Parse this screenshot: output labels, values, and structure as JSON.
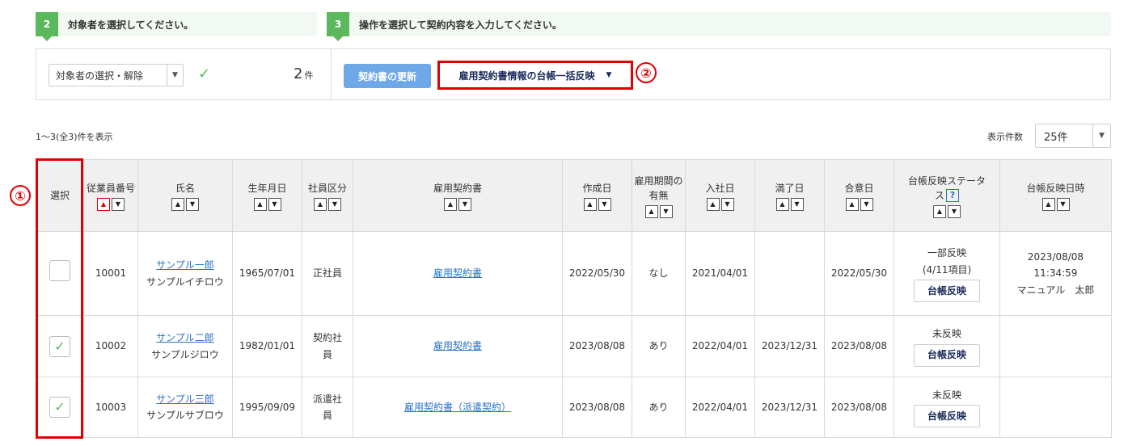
{
  "steps": [
    {
      "num": "2",
      "title": "対象者を選択してください。"
    },
    {
      "num": "3",
      "title": "操作を選択して契約内容を入力してください。"
    }
  ],
  "action_bar": {
    "target_select_label": "対象者の選択・解除",
    "count": "2",
    "count_unit": "件",
    "update_button": "契約書の更新",
    "bulk_button": "雇用契約書情報の台帳一括反映"
  },
  "markers": {
    "one": "①",
    "two": "②"
  },
  "list": {
    "range_text": "1～3(全3)件を表示",
    "per_page_label": "表示件数",
    "per_page_value": "25件"
  },
  "table": {
    "headers": {
      "select": "選択",
      "emp_no": "従業員番号",
      "name": "氏名",
      "birth": "生年月日",
      "emp_type": "社員区分",
      "contract": "雇用契約書",
      "created": "作成日",
      "period": "雇用期間の有無",
      "join": "入社日",
      "expire": "満了日",
      "agree": "合意日",
      "status": "台帳反映ステータス",
      "reflected_at": "台帳反映日時"
    },
    "rows": [
      {
        "checked": false,
        "emp_no": "10001",
        "name": "サンプル一郎",
        "kana": "サンプルイチロウ",
        "birth": "1965/07/01",
        "emp_type": "正社員",
        "contract": "雇用契約書",
        "created": "2022/05/30",
        "period": "なし",
        "join": "2021/04/01",
        "expire": "",
        "agree": "2022/05/30",
        "status": "一部反映",
        "status_detail": "(4/11項目)",
        "button": "台帳反映",
        "reflected_date": "2023/08/08",
        "reflected_time": "11:34:59",
        "reflected_by": "マニュアル　太郎"
      },
      {
        "checked": true,
        "emp_no": "10002",
        "name": "サンプル二郎",
        "kana": "サンプルジロウ",
        "birth": "1982/01/01",
        "emp_type": "契約社員",
        "contract": "雇用契約書",
        "created": "2023/08/08",
        "period": "あり",
        "join": "2022/04/01",
        "expire": "2023/12/31",
        "agree": "2023/08/08",
        "status": "未反映",
        "status_detail": "",
        "button": "台帳反映",
        "reflected_date": "",
        "reflected_time": "",
        "reflected_by": ""
      },
      {
        "checked": true,
        "emp_no": "10003",
        "name": "サンプル三郎",
        "kana": "サンプルサブロウ",
        "birth": "1995/09/09",
        "emp_type": "派遣社員",
        "contract": "雇用契約書（派遣契約）",
        "created": "2023/08/08",
        "period": "あり",
        "join": "2022/04/01",
        "expire": "2023/12/31",
        "agree": "2023/08/08",
        "status": "未反映",
        "status_detail": "",
        "button": "台帳反映",
        "reflected_date": "",
        "reflected_time": "",
        "reflected_by": ""
      }
    ]
  },
  "colors": {
    "accent_green": "#5cb85c",
    "highlight_red": "#e00000",
    "link_blue": "#2a72c4",
    "button_blue": "#6fa8e8"
  }
}
